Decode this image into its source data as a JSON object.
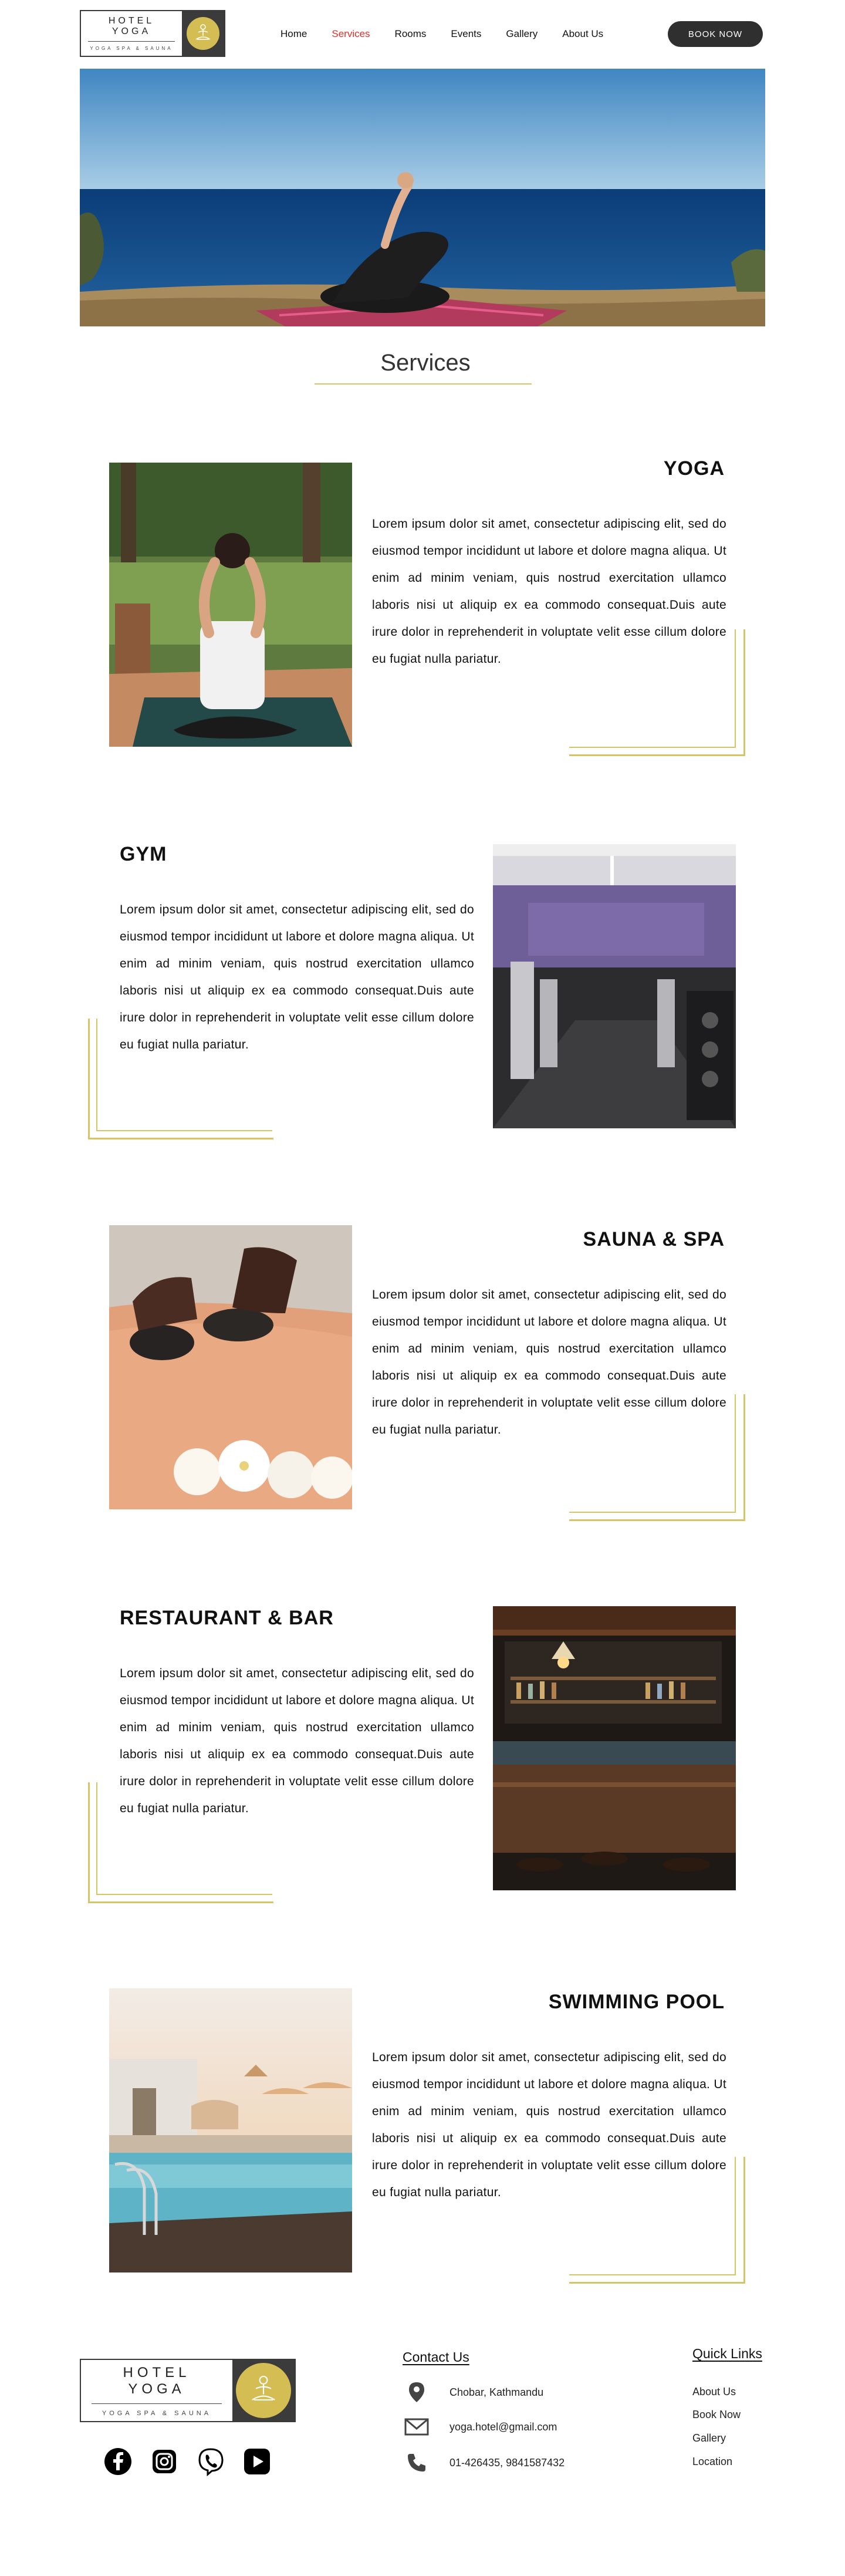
{
  "brand": {
    "name": "HOTEL YOGA",
    "tagline": "YOGA SPA & SAUNA"
  },
  "nav": {
    "items": [
      "Home",
      "Services",
      "Rooms",
      "Events",
      "Gallery",
      "About Us"
    ],
    "active": "Services",
    "book_label": "BOOK NOW"
  },
  "page": {
    "section_title": "Services"
  },
  "services": [
    {
      "title": "YOGA",
      "text": "Lorem ipsum dolor sit amet, consectetur adipiscing elit, sed do eiusmod tempor incididunt ut labore et dolore magna aliqua. Ut enim ad minim veniam, quis nostrud exercitation ullamco laboris nisi ut aliquip ex ea commodo consequat.Duis aute irure dolor in reprehenderit in voluptate velit esse cillum dolore eu fugiat nulla pariatur."
    },
    {
      "title": "GYM",
      "text": "Lorem ipsum dolor sit amet, consectetur adipiscing elit, sed do eiusmod tempor incididunt ut labore et dolore magna aliqua. Ut enim ad minim veniam, quis nostrud exercitation ullamco laboris nisi ut aliquip ex ea commodo consequat.Duis aute irure dolor in reprehenderit in voluptate velit esse cillum dolore eu fugiat nulla pariatur."
    },
    {
      "title": "SAUNA & SPA",
      "text": "Lorem ipsum dolor sit amet, consectetur adipiscing elit, sed do eiusmod tempor incididunt ut labore et dolore magna aliqua. Ut enim ad minim veniam, quis nostrud exercitation ullamco laboris nisi ut aliquip ex ea commodo consequat.Duis aute irure dolor in reprehenderit in voluptate velit esse cillum dolore eu fugiat nulla pariatur."
    },
    {
      "title": "RESTAURANT & BAR",
      "text": "Lorem ipsum dolor sit amet, consectetur adipiscing elit, sed do eiusmod tempor incididunt ut labore et dolore magna aliqua. Ut enim ad minim veniam, quis nostrud exercitation ullamco laboris nisi ut aliquip ex ea commodo consequat.Duis aute irure dolor in reprehenderit in voluptate velit esse cillum dolore eu fugiat nulla pariatur."
    },
    {
      "title": "SWIMMING POOL",
      "text": "Lorem ipsum dolor sit amet, consectetur adipiscing elit, sed do eiusmod tempor incididunt ut labore et dolore magna aliqua. Ut enim ad minim veniam, quis nostrud exercitation ullamco laboris nisi ut aliquip ex ea commodo consequat.Duis aute irure dolor in reprehenderit in voluptate velit esse cillum dolore eu fugiat nulla pariatur."
    }
  ],
  "footer": {
    "contact_heading": "Contact Us",
    "address": "Chobar, Kathmandu",
    "email": "yoga.hotel@gmail.com",
    "phone": "01-426435, 9841587432",
    "quick_links_heading": "Quick Links",
    "quick_links": [
      "About Us",
      "Book Now",
      "Gallery",
      "Location"
    ],
    "social_icons": [
      "facebook-icon",
      "instagram-icon",
      "viber-icon",
      "youtube-icon"
    ]
  },
  "colors": {
    "accent_gold": "#d8c468",
    "active_nav": "#e0302a",
    "dark": "#2f2f2f"
  }
}
